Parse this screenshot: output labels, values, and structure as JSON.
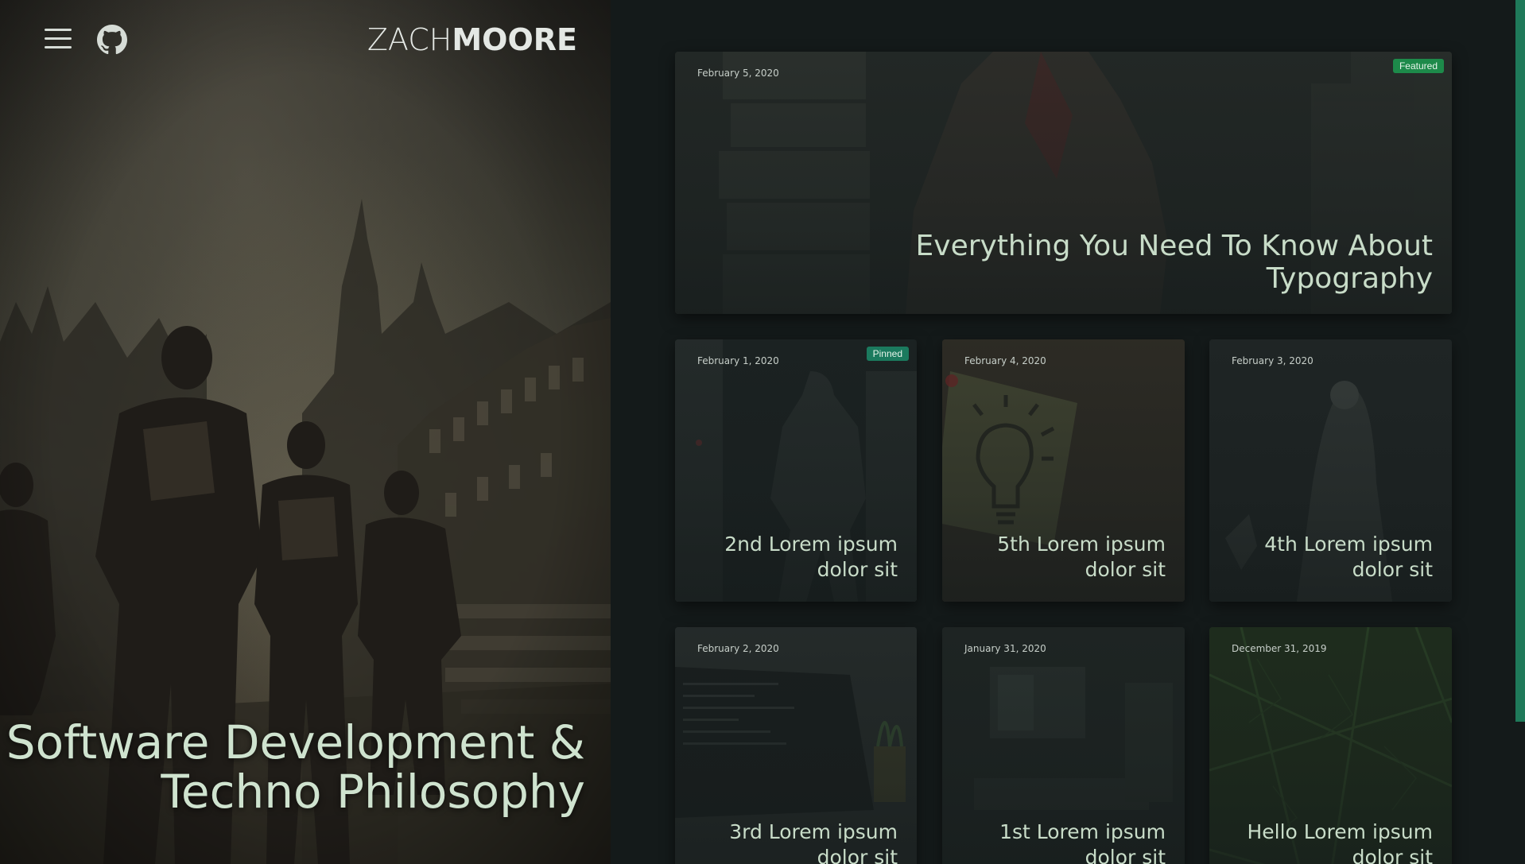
{
  "site": {
    "logo_light": "ZACH",
    "logo_bold": "MOORE",
    "hero_line1": "Software Development &",
    "hero_line2": "Techno Philosophy"
  },
  "icons": {
    "menu": "hamburger-icon",
    "github": "github-icon"
  },
  "colors": {
    "accent": "#1f7a5a",
    "badge_featured": "#1d8a4a",
    "badge_pinned": "#1b7a5e",
    "title_text": "#c8dcc8"
  },
  "featured": {
    "date": "February 5, 2020",
    "badge": "Featured",
    "title_line1": "Everything You Need To Know About",
    "title_line2": "Typography"
  },
  "posts": [
    {
      "date": "February 1, 2020",
      "badge": "Pinned",
      "title_line1": "2nd Lorem ipsum",
      "title_line2": "dolor sit"
    },
    {
      "date": "February 4, 2020",
      "title_line1": "5th Lorem ipsum",
      "title_line2": "dolor sit"
    },
    {
      "date": "February 3, 2020",
      "title_line1": "4th Lorem ipsum",
      "title_line2": "dolor sit"
    },
    {
      "date": "February 2, 2020",
      "title_line1": "3rd Lorem ipsum",
      "title_line2": "dolor sit"
    },
    {
      "date": "January 31, 2020",
      "title_line1": "1st Lorem ipsum",
      "title_line2": "dolor sit"
    },
    {
      "date": "December 31, 2019",
      "title_line1": "Hello Lorem ipsum",
      "title_line2": "dolor sit"
    }
  ]
}
